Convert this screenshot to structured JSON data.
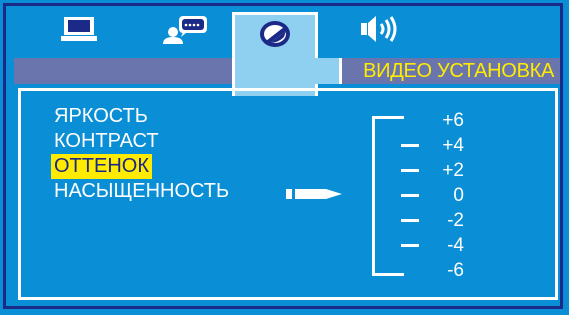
{
  "header": {
    "title": "ВИДЕО УСТАНОВКА"
  },
  "tabs": [
    {
      "icon": "monitor-icon",
      "active": false
    },
    {
      "icon": "person-chat-icon",
      "active": false
    },
    {
      "icon": "color-disc-icon",
      "active": true
    },
    {
      "icon": "speaker-icon",
      "active": false
    }
  ],
  "menu": {
    "items": [
      "ЯРКОСТЬ",
      "КОНТРАСТ",
      "ОТТЕНОК",
      "НАСЫЩЕННОСТЬ"
    ],
    "selected_index": 2
  },
  "scale": {
    "labels": [
      "+6",
      "+4",
      "+2",
      "0",
      "-2",
      "-4",
      "-6"
    ]
  },
  "colors": {
    "background": "#0a8fd6",
    "frame": "#1b2a86",
    "title": "#ffeb00",
    "highlight": "#ffeb00",
    "header_bar": "#6b75ad",
    "active_tab": "#8fd0f0"
  }
}
